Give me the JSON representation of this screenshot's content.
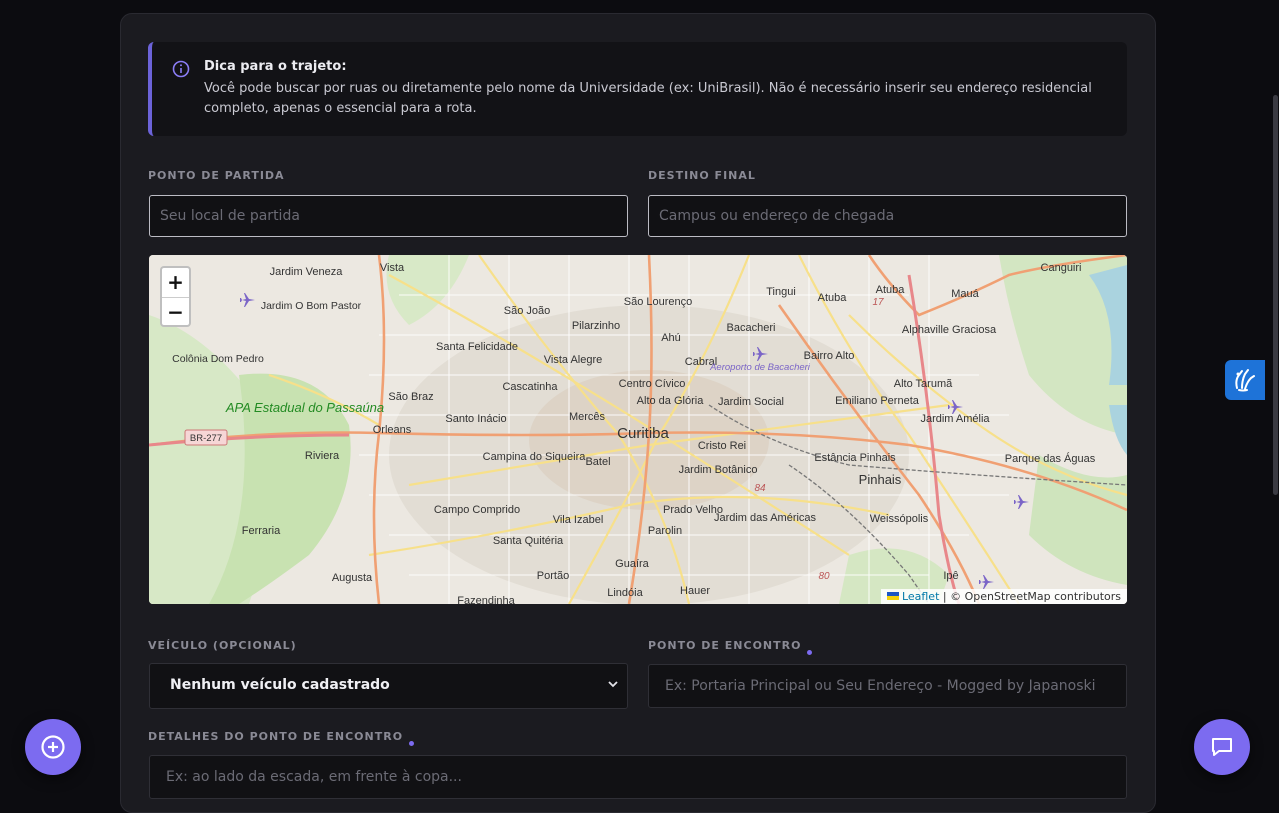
{
  "tip": {
    "title": "Dica para o trajeto:",
    "text": "Você pode buscar por ruas ou diretamente pelo nome da Universidade (ex: UniBrasil). Não é necessário inserir seu endereço residencial completo, apenas o essencial para a rota."
  },
  "route": {
    "origin_label": "PONTO DE PARTIDA",
    "origin_placeholder": "Seu local de partida",
    "destination_label": "DESTINO FINAL",
    "destination_placeholder": "Campus ou endereço de chegada"
  },
  "map": {
    "zoom_in": "+",
    "zoom_out": "−",
    "attribution_link": "Leaflet",
    "attribution_text": "| © OpenStreetMap contributors",
    "places": [
      "Jardim Veneza",
      "Vista",
      "São Lourenço",
      "Tingui",
      "Atuba",
      "Canguiri",
      "Mauá",
      "Jardim O Bom Pastor",
      "São João",
      "Pilarzinho",
      "Bacacheri",
      "Alphaville Graciosa",
      "Santa Felicidade",
      "Ahú",
      "Cabral",
      "Bairro Alto",
      "Colônia Dom Pedro",
      "Vista Alegre",
      "Aeroporto de Bacacheri",
      "Cascatinha",
      "Centro Cívico",
      "Alto Tarumã",
      "São Braz",
      "Alto da Glória",
      "Jardim Social",
      "Emiliano Perneta",
      "APA Estadual do Passaúna",
      "Santo Inácio",
      "Mercês",
      "Jardim Amélia",
      "BR-277",
      "Orleans",
      "Curitiba",
      "Cristo Rei",
      "Riviera",
      "Campina do Siqueira",
      "Batel",
      "Jardim Botânico",
      "Estância Pinhais",
      "Parque das Águas",
      "Pinhais",
      "Campo Comprido",
      "Prado Velho",
      "Vila Izabel",
      "Jardim das Américas",
      "Ferraria",
      "Weissópolis",
      "Parolin",
      "Santa Quitéria",
      "Guaíra",
      "Portão",
      "Augusta",
      "Lindóia",
      "Hauer",
      "Ipê",
      "Fazendinha",
      "84",
      "80",
      "17"
    ]
  },
  "vehicle": {
    "label": "VEÍCULO (OPCIONAL)",
    "selected": "Nenhum veículo cadastrado"
  },
  "meeting": {
    "label": "PONTO DE ENCONTRO",
    "placeholder": "Ex: Portaria Principal ou Seu Endereço - Mogged by Japanoski",
    "details_label": "DETALHES DO PONTO DE ENCONTRO",
    "details_placeholder": "Ex: ao lado da escada, em frente à copa..."
  },
  "icons": {
    "add": "plus-circle-icon",
    "chat": "chat-icon",
    "accessibility": "sign-language-icon",
    "info": "info-icon"
  },
  "colors": {
    "accent": "#7c6bf0",
    "background": "#0c0c10",
    "card": "#1b1b20"
  }
}
